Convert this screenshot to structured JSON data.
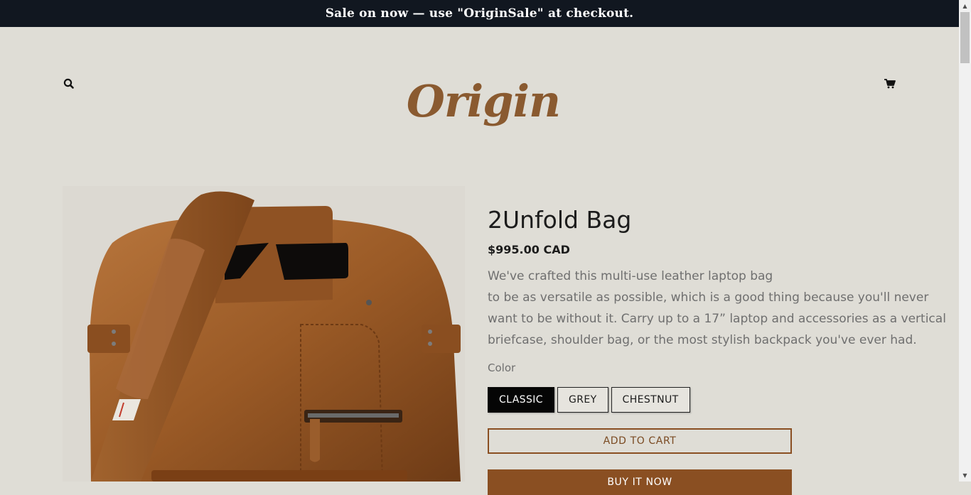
{
  "announcement": {
    "text": "Sale on now — use \"OriginSale\" at checkout."
  },
  "header": {
    "logo_text": "Origin",
    "search_icon": "search-icon",
    "cart_icon": "cart-icon"
  },
  "product": {
    "title": "2Unfold Bag",
    "price": "$995.00 CAD",
    "description_lines": [
      "We've crafted this multi-use leather laptop bag",
      "to be as versatile as possible, which is a good thing because you'll never",
      "want to be without it. Carry up to a 17” laptop and accessories as a vertical",
      "briefcase, shoulder bag, or the most stylish backpack you've ever had."
    ],
    "color_label": "Color",
    "colors": [
      "CLASSIC",
      "GREY",
      "CHESTNUT"
    ],
    "selected_color": "CLASSIC",
    "add_to_cart_label": "ADD TO CART",
    "buy_now_label": "BUY IT NOW"
  },
  "theme": {
    "accent": "#8a4f22",
    "background": "#dfddd6",
    "announcement_bg": "#111720"
  }
}
